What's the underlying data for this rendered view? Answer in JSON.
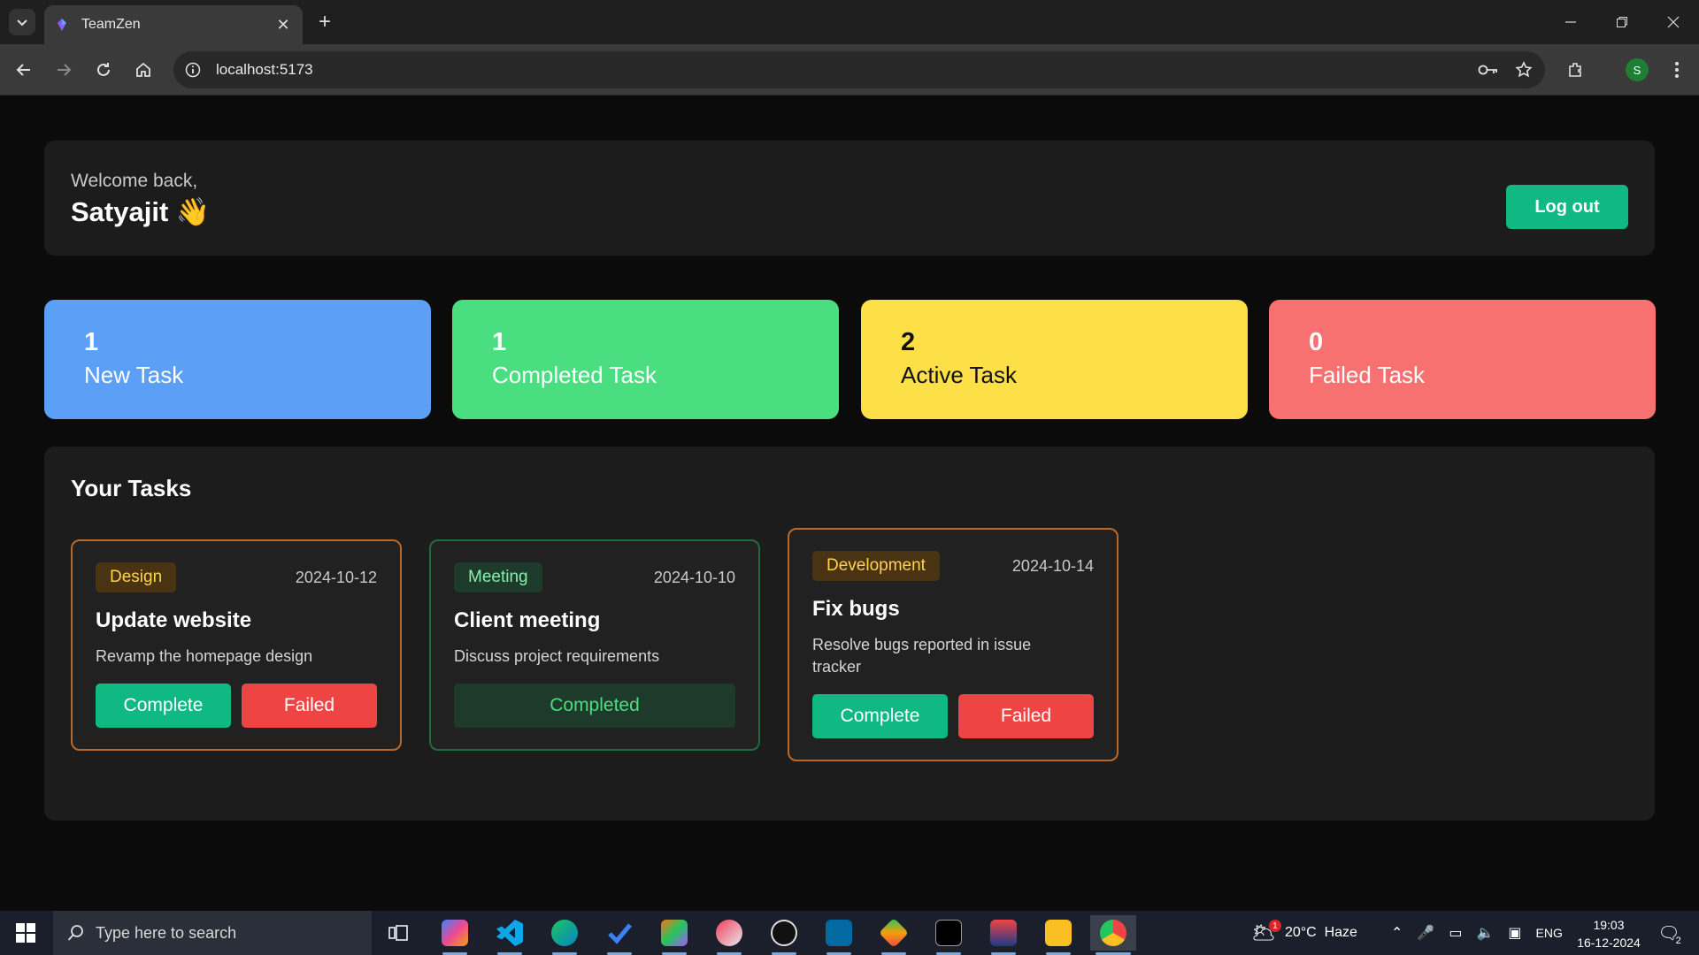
{
  "browser": {
    "tab_title": "TeamZen",
    "url": "localhost:5173",
    "profile_initial": "S"
  },
  "header": {
    "welcome": "Welcome back,",
    "username": "Satyajit 👋",
    "logout_label": "Log out"
  },
  "stats": [
    {
      "count": "1",
      "label": "New Task",
      "color": "#5b9ff6"
    },
    {
      "count": "1",
      "label": "Completed Task",
      "color": "#4ade80"
    },
    {
      "count": "2",
      "label": "Active Task",
      "color": "#fde047"
    },
    {
      "count": "0",
      "label": "Failed Task",
      "color": "#f87171"
    }
  ],
  "tasks_panel": {
    "title": "Your Tasks",
    "tasks": [
      {
        "category": "Design",
        "date": "2024-10-12",
        "title": "Update website",
        "description": "Revamp the homepage design",
        "complete_label": "Complete",
        "failed_label": "Failed"
      },
      {
        "category": "Meeting",
        "date": "2024-10-10",
        "title": "Client meeting",
        "description": "Discuss project requirements",
        "status_label": "Completed"
      },
      {
        "category": "Development",
        "date": "2024-10-14",
        "title": "Fix bugs",
        "description": "Resolve bugs reported in issue tracker",
        "complete_label": "Complete",
        "failed_label": "Failed"
      }
    ]
  },
  "taskbar": {
    "search_placeholder": "Type here to search",
    "weather": "20°C  Haze",
    "language": "ENG",
    "time": "19:03",
    "date": "16-12-2024",
    "notification_count": "2",
    "weather_badge": "1"
  }
}
